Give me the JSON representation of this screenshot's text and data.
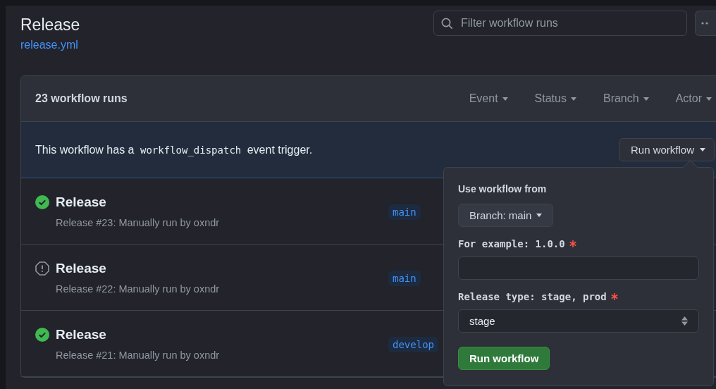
{
  "header": {
    "title": "Release",
    "file_link": "release.yml",
    "search": {
      "placeholder": "Filter workflow runs"
    }
  },
  "runs_panel": {
    "count_label": "23 workflow runs",
    "filters": [
      {
        "label": "Event"
      },
      {
        "label": "Status"
      },
      {
        "label": "Branch"
      },
      {
        "label": "Actor"
      }
    ],
    "banner": {
      "text_before": "This workflow has a",
      "code": "workflow_dispatch",
      "text_after": "event trigger.",
      "button": "Run workflow"
    },
    "runs": [
      {
        "kind": "success",
        "title": "Release",
        "subtitle": "Release #23: Manually run by oxndr",
        "branch": "main"
      },
      {
        "kind": "cancelled",
        "title": "Release",
        "subtitle": "Release #22: Manually run by oxndr",
        "branch": "main"
      },
      {
        "kind": "success",
        "title": "Release",
        "subtitle": "Release #21: Manually run by oxndr",
        "branch": "develop"
      }
    ]
  },
  "run_popup": {
    "source_label": "Use workflow from",
    "branch_button": "Branch: main",
    "inputs": [
      {
        "kind": "text",
        "label": "For example: 1.0.0",
        "required": true
      },
      {
        "kind": "select",
        "label": "Release type: stage, prod",
        "required": true,
        "value": "stage"
      }
    ],
    "submit": "Run workflow"
  }
}
